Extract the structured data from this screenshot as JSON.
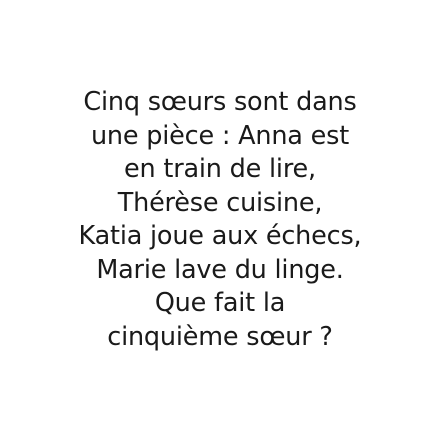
{
  "riddle": {
    "lines": [
      "Cinq sœurs sont dans",
      "une pièce : Anna est",
      "en train de lire,",
      "Thérèse cuisine,",
      "Katia joue aux échecs,",
      "Marie lave du linge.",
      "Que fait la",
      "cinquième sœur ?"
    ]
  }
}
